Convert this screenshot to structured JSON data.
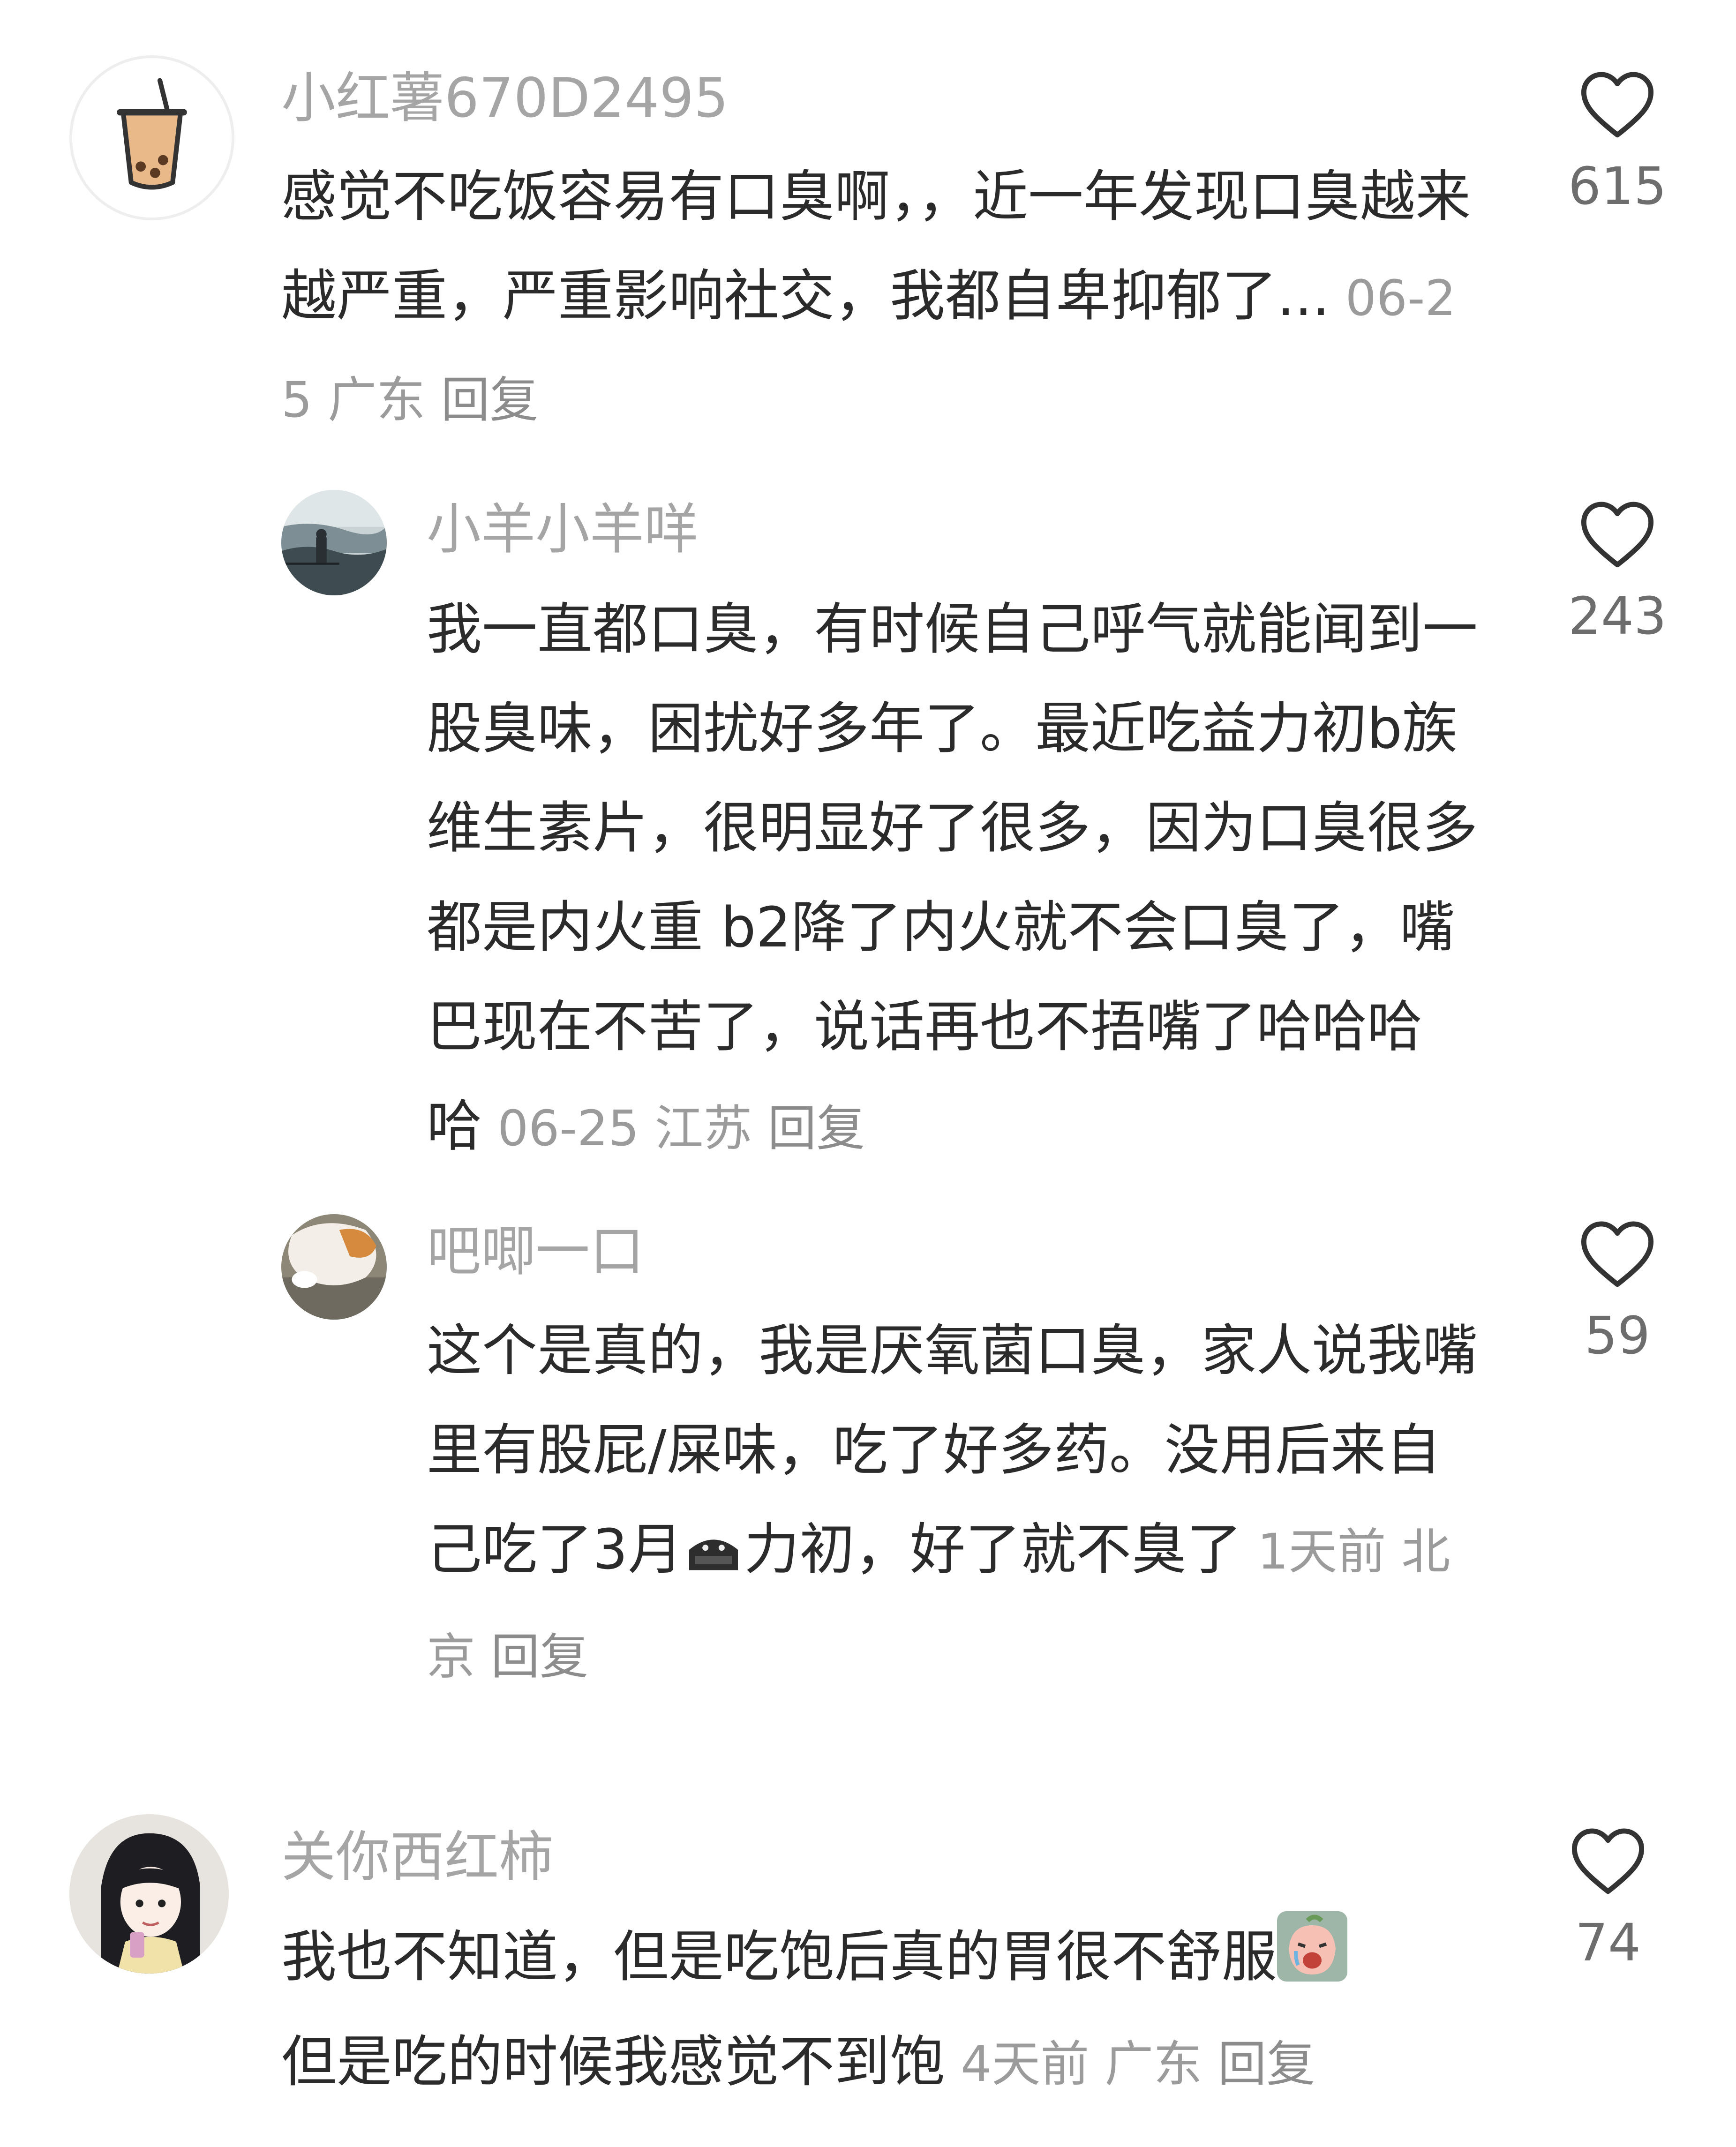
{
  "comments": [
    {
      "username": "小红薯670D2495",
      "text": "感觉不吃饭容易有口臭啊，，近一年发现口臭越来越严重，严重影响社交，我都自卑抑郁了...",
      "date": "06-25",
      "location": "广东",
      "reply_label": "回复",
      "likes": "615",
      "avatar_icon": "bubble-tea-icon"
    },
    {
      "username": "小羊小羊咩",
      "text": "我一直都口臭，有时候自己呼气就能闻到一股臭味，困扰好多年了。最近吃益力初b族维生素片，很明显好了很多，因为口臭很多都是内火重 b2降了内火就不会口臭了，嘴巴现在不苦了，说话再也不捂嘴了哈哈哈哈",
      "date": "06-25",
      "location": "江苏",
      "reply_label": "回复",
      "likes": "243",
      "avatar_icon": "seaside-photo-icon"
    },
    {
      "username": "吧唧一口",
      "text_before_icon": "这个是真的，我是厌氧菌口臭，家人说我嘴里有股屁/屎味，吃了好多药。没用后来自己吃了3月",
      "text_after_icon": "力初，好了就不臭了",
      "inline_icon": "masked-character-icon",
      "date": "1天前",
      "location": "北京",
      "reply_label": "回复",
      "likes": "59",
      "avatar_icon": "cat-photo-icon"
    },
    {
      "username": "关你西红柿",
      "text_line1": "我也不知道，但是吃饱后真的胃很不舒服",
      "text_line2": "但是吃的时候我感觉不到饱",
      "inline_icon": "crying-peach-emoji-icon",
      "date": "4天前",
      "location": "广东",
      "reply_label": "回复",
      "likes": "74",
      "avatar_icon": "anime-girl-icon"
    }
  ],
  "colors": {
    "text": "#2b2b2b",
    "username": "#a5a5a5",
    "meta": "#9b9b9b",
    "like_count": "#6d6d6d"
  }
}
